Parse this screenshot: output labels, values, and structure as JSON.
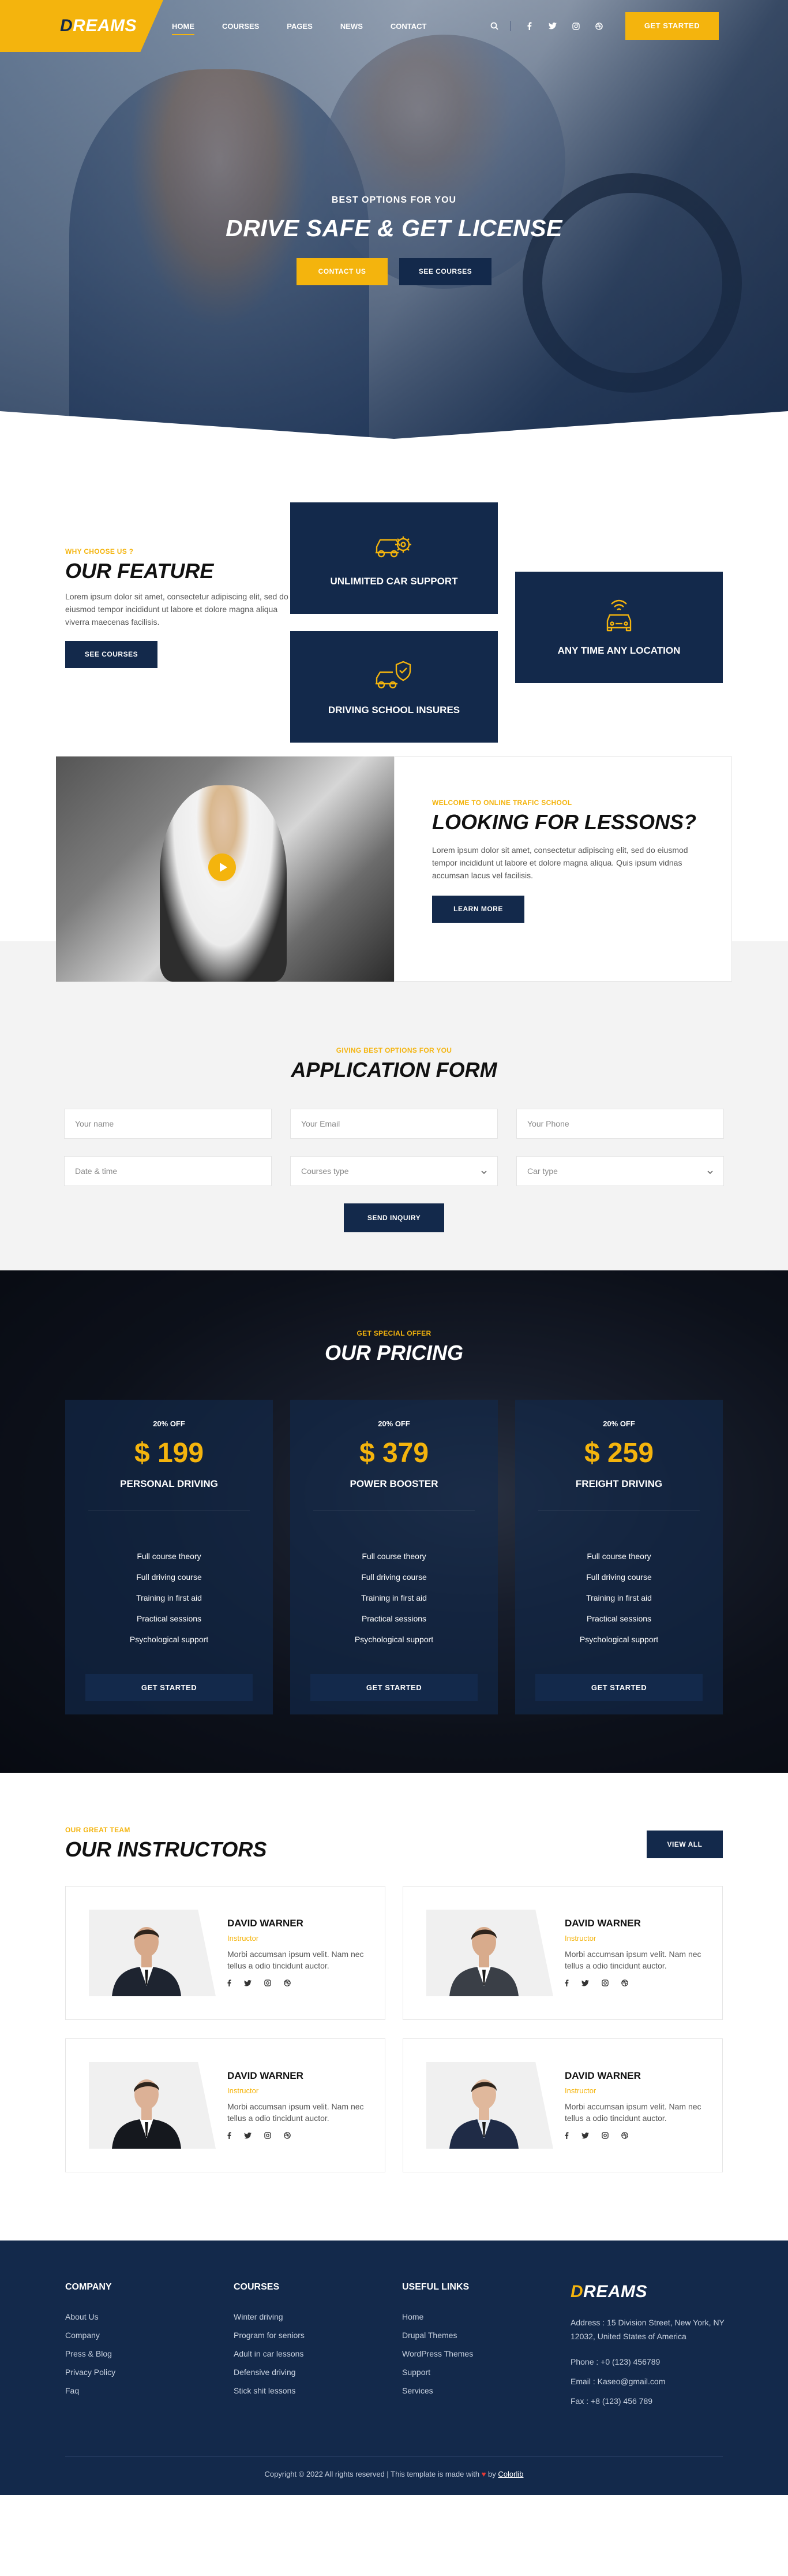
{
  "header": {
    "logo_first": "D",
    "logo_rest": "REAMS",
    "nav": [
      "HOME",
      "COURSES",
      "PAGES",
      "NEWS",
      "CONTACT"
    ],
    "cta": "GET STARTED",
    "icons": [
      "search-icon",
      "facebook-icon",
      "twitter-icon",
      "instagram-icon",
      "dribbble-icon"
    ]
  },
  "hero": {
    "subtitle": "BEST OPTIONS FOR YOU",
    "title": "DRIVE SAFE & GET LICENSE",
    "btn_contact": "CONTACT US",
    "btn_courses": "SEE COURSES"
  },
  "features": {
    "eyebrow": "WHY CHOOSE US ?",
    "title": "OUR FEATURE",
    "text": "Lorem ipsum dolor sit amet, consectetur adipiscing elit, sed do eiusmod tempor incididunt ut labore et dolore magna aliqua viverra maecenas facilisis.",
    "button": "SEE COURSES",
    "cards": [
      {
        "label": "UNLIMITED CAR SUPPORT",
        "icon": "car-gear-icon"
      },
      {
        "label": "DRIVING SCHOOL INSURES",
        "icon": "car-shield-icon"
      },
      {
        "label": "ANY TIME ANY LOCATION",
        "icon": "car-signal-icon"
      }
    ]
  },
  "lessons": {
    "eyebrow": "WELCOME TO ONLINE TRAFIC SCHOOL",
    "title": "LOOKING FOR LESSONS?",
    "text": "Lorem ipsum dolor sit amet, consectetur adipiscing elit, sed do eiusmod tempor incididunt ut labore et dolore magna aliqua. Quis ipsum vidnas accumsan lacus vel facilisis.",
    "button": "LEARN MORE"
  },
  "form": {
    "eyebrow": "GIVING BEST OPTIONS FOR YOU",
    "title": "APPLICATION FORM",
    "name_ph": "Your name",
    "email_ph": "Your Email",
    "phone_ph": "Your Phone",
    "date_ph": "Date & time",
    "courses_sel": "Courses type",
    "car_sel": "Car type",
    "button": "SEND INQUIRY"
  },
  "pricing": {
    "eyebrow": "GET SPECIAL OFFER",
    "title": "OUR PRICING",
    "plans": [
      {
        "off": "20% OFF",
        "price": "$ 199",
        "name": "PERSONAL DRIVING"
      },
      {
        "off": "20% OFF",
        "price": "$ 379",
        "name": "POWER BOOSTER"
      },
      {
        "off": "20% OFF",
        "price": "$ 259",
        "name": "FREIGHT DRIVING"
      }
    ],
    "features": [
      "Full course theory",
      "Full driving course",
      "Training in first aid",
      "Practical sessions",
      "Psychological support"
    ],
    "button": "GET STARTED"
  },
  "instructors": {
    "eyebrow": "OUR GREAT TEAM",
    "title": "OUR INSTRUCTORS",
    "view_all": "VIEW ALL",
    "list": [
      {
        "name": "DAVID WARNER",
        "role": "Instructor",
        "desc": "Morbi accumsan ipsum velit. Nam nec tellus a odio tincidunt auctor.",
        "suit": "#1e2430",
        "shirt": "#ffffff",
        "skin": "#d7a98a"
      },
      {
        "name": "DAVID WARNER",
        "role": "Instructor",
        "desc": "Morbi accumsan ipsum velit. Nam nec tellus a odio tincidunt auctor.",
        "suit": "#3a3f47",
        "shirt": "#ffffff",
        "skin": "#d8ab8c"
      },
      {
        "name": "DAVID WARNER",
        "role": "Instructor",
        "desc": "Morbi accumsan ipsum velit. Nam nec tellus a odio tincidunt auctor.",
        "suit": "#15181e",
        "shirt": "#ffffff",
        "skin": "#dcb196"
      },
      {
        "name": "DAVID WARNER",
        "role": "Instructor",
        "desc": "Morbi accumsan ipsum velit. Nam nec tellus a odio tincidunt auctor.",
        "suit": "#1f2b46",
        "shirt": "#e8edf5",
        "skin": "#e0b89c"
      }
    ]
  },
  "footer": {
    "company_title": "COMPANY",
    "company": [
      "About Us",
      "Company",
      "Press & Blog",
      "Privacy Policy",
      "Faq"
    ],
    "courses_title": "COURSES",
    "courses": [
      "Winter driving",
      "Program for seniors",
      "Adult in car lessons",
      "Defensive driving",
      "Stick shit lessons"
    ],
    "links_title": "USEFUL LINKS",
    "links": [
      "Home",
      "Drupal Themes",
      "WordPress Themes",
      "Support",
      "Services"
    ],
    "logo_first": "D",
    "logo_rest": "REAMS",
    "address": "Address : 15 Division Street, New York, NY 12032, United States of America",
    "phone": "Phone : +0 (123) 456789",
    "email": "Email : Kaseo@gmail.com",
    "fax": "Fax : +8 (123) 456 789",
    "copyright": "Copyright © 2022 All rights reserved | This template is made with",
    "heart": "♥",
    "by": "by",
    "author": "Colorlib"
  },
  "colors": {
    "navy": "#13294b",
    "yellow": "#f4b40d"
  }
}
